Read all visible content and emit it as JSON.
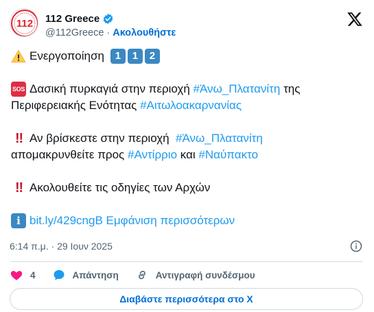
{
  "author": {
    "display_name": "112 Greece",
    "handle": "@112Greece",
    "separator": "·",
    "follow_label": "Ακολουθήστε",
    "avatar_text": "112",
    "verified_icon": "verified-badge-icon"
  },
  "tweet": {
    "line1": {
      "emoji": "warning",
      "text": "Ενεργοποίηση",
      "keycaps": [
        "1",
        "1",
        "2"
      ]
    },
    "line2": {
      "emoji": "sos",
      "emoji_text": "SOS",
      "text": "Δασική πυρκαγιά στην περιοχή",
      "hashtag": "#Άνω_Πλατανίτη",
      "tail": "της"
    },
    "line3": {
      "text": "Περιφερειακής Ενότητας",
      "hashtag": "#Αιτωλοακαρνανίας"
    },
    "line4": {
      "emoji": "double-exclamation",
      "emoji_text": "‼",
      "text": "Αν βρίσκεστε στην περιοχή",
      "hashtag": "#Άνω_Πλατανίτη"
    },
    "line5": {
      "text": "απομακρυνθείτε προς",
      "hashtag1": "#Αντίρριο",
      "connector": "και",
      "hashtag2": "#Ναύπακτο"
    },
    "line6": {
      "emoji": "double-exclamation",
      "emoji_text": "‼",
      "text": "Ακολουθείτε τις οδηγίες των Αρχών"
    },
    "line7": {
      "emoji": "information",
      "emoji_text": "i",
      "link": "bit.ly/429cngB",
      "show_more": "Εμφάνιση περισσότερων"
    }
  },
  "meta": {
    "timestamp": "6:14 π.μ. · 29 Ιουν 2025"
  },
  "actions": {
    "like_count": "4",
    "reply_label": "Απάντηση",
    "copy_link_label": "Αντιγραφή συνδέσμου"
  },
  "read_more_label": "Διαβάστε περισσότερα στο Χ",
  "colors": {
    "link": "#1d9bf0",
    "follow": "#006fd6",
    "like": "#f91880",
    "keycap": "#3b88c3",
    "sos": "#dd2e44",
    "secondary": "#536471"
  }
}
